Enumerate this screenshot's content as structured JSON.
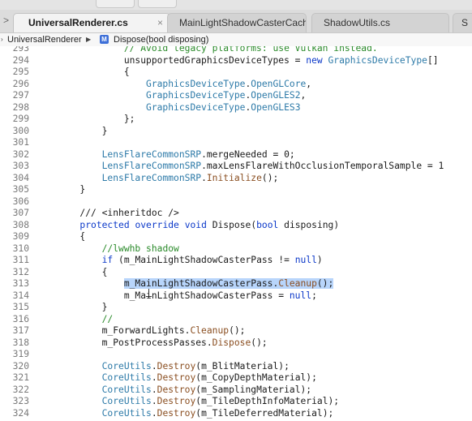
{
  "tabs": [
    {
      "label": "UniversalRenderer.cs",
      "close": "×",
      "active": true
    },
    {
      "label": "MainLightShadowCasterCache",
      "close": "",
      "active": false
    },
    {
      "label": "ShadowUtils.cs",
      "close": "",
      "active": false
    },
    {
      "label": "S",
      "close": "",
      "active": false
    }
  ],
  "tab_arrow": ">",
  "breadcrumb": {
    "class_name": "UniversalRenderer",
    "separator": "▶",
    "method_icon": "M",
    "method_name": "Dispose(bool disposing)"
  },
  "code_lines": [
    {
      "n": "293",
      "indent": "                ",
      "parts": [
        [
          "cm",
          "// Avoid legacy platforms: use Vulkan instead."
        ]
      ]
    },
    {
      "n": "294",
      "indent": "                ",
      "parts": [
        [
          "",
          "unsupportedGraphicsDeviceTypes = "
        ],
        [
          "kw",
          "new"
        ],
        [
          "",
          " "
        ],
        [
          "ty",
          "GraphicsDeviceType"
        ],
        [
          "",
          "[]"
        ]
      ]
    },
    {
      "n": "295",
      "indent": "                ",
      "parts": [
        [
          "",
          "{"
        ]
      ]
    },
    {
      "n": "296",
      "indent": "                    ",
      "parts": [
        [
          "ty",
          "GraphicsDeviceType"
        ],
        [
          "",
          "."
        ],
        [
          "ty",
          "OpenGLCore"
        ],
        [
          "",
          ","
        ]
      ]
    },
    {
      "n": "297",
      "indent": "                    ",
      "parts": [
        [
          "ty",
          "GraphicsDeviceType"
        ],
        [
          "",
          "."
        ],
        [
          "ty",
          "OpenGLES2"
        ],
        [
          "",
          ","
        ]
      ]
    },
    {
      "n": "298",
      "indent": "                    ",
      "parts": [
        [
          "ty",
          "GraphicsDeviceType"
        ],
        [
          "",
          "."
        ],
        [
          "ty",
          "OpenGLES3"
        ]
      ]
    },
    {
      "n": "299",
      "indent": "                ",
      "parts": [
        [
          "",
          "};"
        ]
      ]
    },
    {
      "n": "300",
      "indent": "            ",
      "parts": [
        [
          "",
          "}"
        ]
      ]
    },
    {
      "n": "301",
      "indent": "",
      "parts": []
    },
    {
      "n": "302",
      "indent": "            ",
      "parts": [
        [
          "ty",
          "LensFlareCommonSRP"
        ],
        [
          "",
          ".mergeNeeded = 0;"
        ]
      ]
    },
    {
      "n": "303",
      "indent": "            ",
      "parts": [
        [
          "ty",
          "LensFlareCommonSRP"
        ],
        [
          "",
          ".maxLensFlareWithOcclusionTemporalSample = 1"
        ]
      ]
    },
    {
      "n": "304",
      "indent": "            ",
      "parts": [
        [
          "ty",
          "LensFlareCommonSRP"
        ],
        [
          "",
          "."
        ],
        [
          "mt",
          "Initialize"
        ],
        [
          "",
          "();"
        ]
      ]
    },
    {
      "n": "305",
      "indent": "        ",
      "parts": [
        [
          "",
          "}"
        ]
      ]
    },
    {
      "n": "306",
      "indent": "",
      "parts": []
    },
    {
      "n": "307",
      "indent": "        ",
      "parts": [
        [
          "",
          "/// <inheritdoc />"
        ]
      ]
    },
    {
      "n": "308",
      "indent": "        ",
      "parts": [
        [
          "kw",
          "protected"
        ],
        [
          "",
          " "
        ],
        [
          "kw",
          "override"
        ],
        [
          "",
          " "
        ],
        [
          "kw",
          "void"
        ],
        [
          "",
          " Dispose("
        ],
        [
          "kw",
          "bool"
        ],
        [
          "",
          " disposing)"
        ]
      ]
    },
    {
      "n": "309",
      "indent": "        ",
      "parts": [
        [
          "",
          "{"
        ]
      ]
    },
    {
      "n": "310",
      "indent": "            ",
      "parts": [
        [
          "cm",
          "//lwwhb shadow"
        ]
      ]
    },
    {
      "n": "311",
      "indent": "            ",
      "parts": [
        [
          "kw",
          "if"
        ],
        [
          "",
          " (m_MainLightShadowCasterPass != "
        ],
        [
          "kw",
          "null"
        ],
        [
          "",
          ")"
        ]
      ]
    },
    {
      "n": "312",
      "indent": "            ",
      "parts": [
        [
          "",
          "{"
        ]
      ]
    },
    {
      "n": "313",
      "indent": "                ",
      "parts": [
        [
          "sel",
          "m_MainLightShadowCasterPass."
        ],
        [
          "sel mt",
          "Cleanup"
        ],
        [
          "sel",
          "();"
        ]
      ]
    },
    {
      "n": "314",
      "indent": "                ",
      "parts": [
        [
          "",
          "m_MainLightShadowCasterPass = "
        ],
        [
          "kw",
          "null"
        ],
        [
          "",
          ";"
        ]
      ]
    },
    {
      "n": "315",
      "indent": "            ",
      "parts": [
        [
          "",
          "}"
        ]
      ]
    },
    {
      "n": "316",
      "indent": "            ",
      "parts": [
        [
          "cm",
          "//"
        ]
      ]
    },
    {
      "n": "317",
      "indent": "            ",
      "parts": [
        [
          "",
          "m_ForwardLights."
        ],
        [
          "mt",
          "Cleanup"
        ],
        [
          "",
          "();"
        ]
      ]
    },
    {
      "n": "318",
      "indent": "            ",
      "parts": [
        [
          "",
          "m_PostProcessPasses."
        ],
        [
          "mt",
          "Dispose"
        ],
        [
          "",
          "();"
        ]
      ]
    },
    {
      "n": "319",
      "indent": "",
      "parts": []
    },
    {
      "n": "320",
      "indent": "            ",
      "parts": [
        [
          "ty",
          "CoreUtils"
        ],
        [
          "",
          "."
        ],
        [
          "mt",
          "Destroy"
        ],
        [
          "",
          "(m_BlitMaterial);"
        ]
      ]
    },
    {
      "n": "321",
      "indent": "            ",
      "parts": [
        [
          "ty",
          "CoreUtils"
        ],
        [
          "",
          "."
        ],
        [
          "mt",
          "Destroy"
        ],
        [
          "",
          "(m_CopyDepthMaterial);"
        ]
      ]
    },
    {
      "n": "322",
      "indent": "            ",
      "parts": [
        [
          "ty",
          "CoreUtils"
        ],
        [
          "",
          "."
        ],
        [
          "mt",
          "Destroy"
        ],
        [
          "",
          "(m_SamplingMaterial);"
        ]
      ]
    },
    {
      "n": "323",
      "indent": "            ",
      "parts": [
        [
          "ty",
          "CoreUtils"
        ],
        [
          "",
          "."
        ],
        [
          "mt",
          "Destroy"
        ],
        [
          "",
          "(m_TileDepthInfoMaterial);"
        ]
      ]
    },
    {
      "n": "324",
      "indent": "            ",
      "parts": [
        [
          "ty",
          "CoreUtils"
        ],
        [
          "",
          "."
        ],
        [
          "mt",
          "Destroy"
        ],
        [
          "",
          "(m_TileDeferredMaterial);"
        ]
      ]
    }
  ],
  "colors": {
    "keyword": "#0b38c9",
    "type": "#2d7aa8",
    "comment": "#2a8a2a",
    "method": "#8a4e20",
    "selection": "#b8d5fb"
  }
}
